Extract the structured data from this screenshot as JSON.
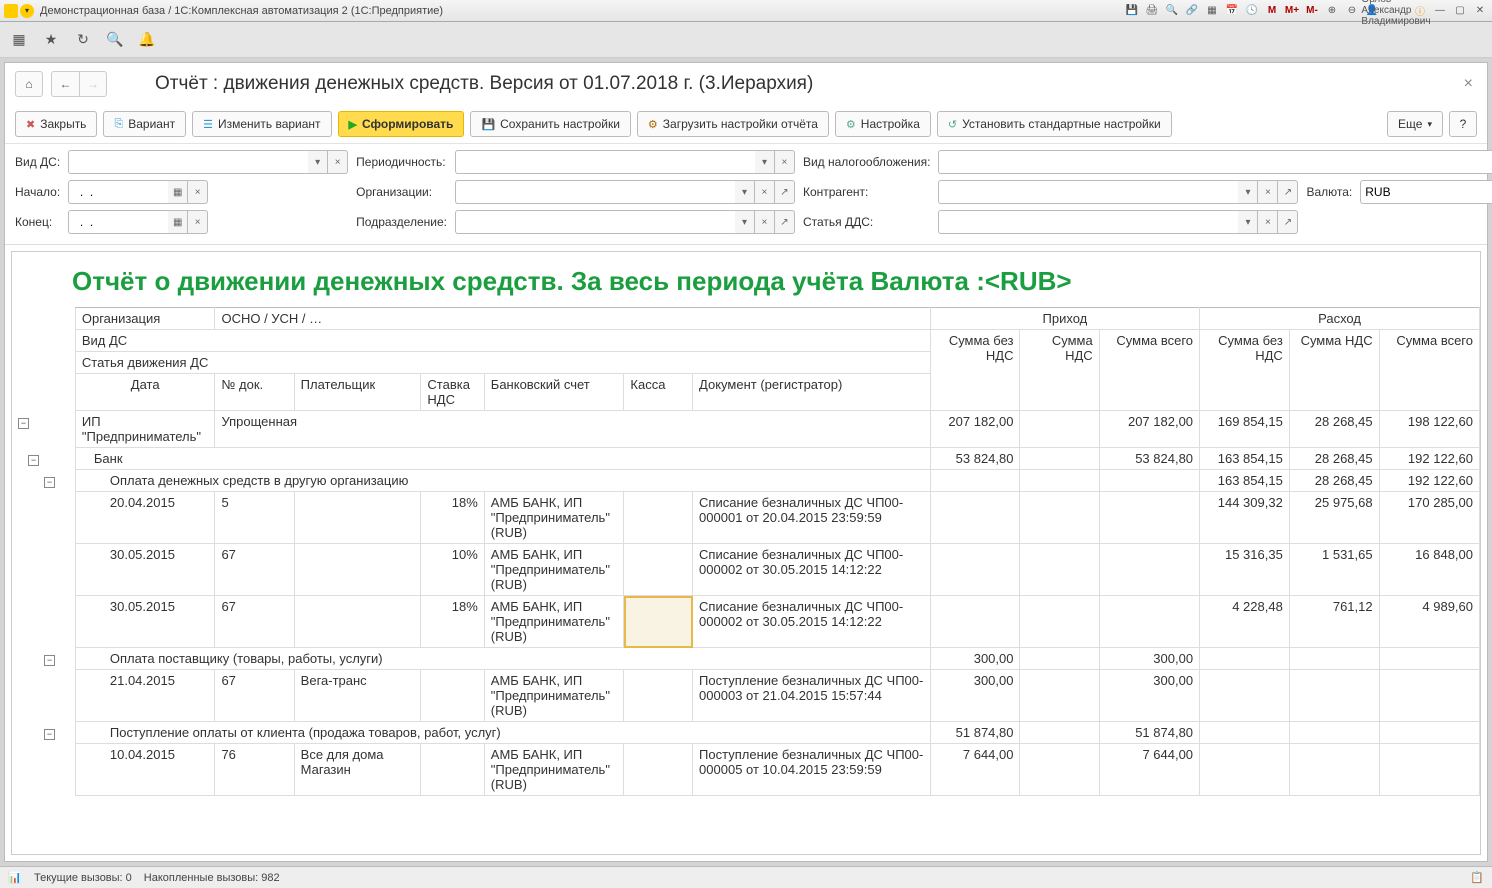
{
  "titlebar": {
    "title": "Демонстрационная база / 1С:Комплексная автоматизация 2  (1С:Предприятие)",
    "user": "Орлов Александр Владимирович",
    "m_labels": [
      "M",
      "M+",
      "M-"
    ]
  },
  "nav_title": "Отчёт : движения денежных средств. Версия от 01.07.2018 г. (3.Иерархия)",
  "cmd": {
    "close": "Закрыть",
    "variant": "Вариант",
    "edit_variant": "Изменить вариант",
    "generate": "Сформировать",
    "save_settings": "Сохранить настройки",
    "load_settings": "Загрузить настройки отчёта",
    "settings": "Настройка",
    "default_settings": "Установить стандартные настройки",
    "more": "Еще"
  },
  "filters": {
    "vid_ds": "Вид ДС:",
    "period": "Периодичность:",
    "tax": "Вид налогообложения:",
    "start": "Начало:",
    "start_val": "  .  .   ",
    "org": "Организации:",
    "contragent": "Контрагент:",
    "currency": "Валюта:",
    "currency_val": "RUB",
    "end": "Конец:",
    "end_val": "  .  .   ",
    "division": "Подразделение:",
    "dds": "Статья ДДС:"
  },
  "report": {
    "title": "Отчёт о движении денежных средств. За весь периода учёта Валюта :<RUB>",
    "org_label": "Организация",
    "tax_mode": "ОСНО / УСН / …",
    "hdr_income": "Приход",
    "hdr_expense": "Расход",
    "hdr_vid_ds": "Вид ДС",
    "hdr_dds": "Статья движения ДС",
    "col_sum_novat": "Сумма без НДС",
    "col_sum_vat": "Сумма НДС",
    "col_sum_total": "Сумма всего",
    "col_date": "Дата",
    "col_docno": "№ док.",
    "col_payer": "Плательщик",
    "col_vat_rate": "Ставка НДС",
    "col_bank": "Банковский счет",
    "col_cash": "Касса",
    "col_doc": "Документ (регистратор)"
  },
  "rows": {
    "r0": {
      "org": "ИП \"Предприниматель\"",
      "tax": "Упрощенная",
      "in_novat": "207 182,00",
      "in_total": "207 182,00",
      "ex_novat": "169 854,15",
      "ex_vat": "28 268,45",
      "ex_total": "198 122,60"
    },
    "r1": {
      "label": "Банк",
      "in_novat": "53 824,80",
      "in_total": "53 824,80",
      "ex_novat": "163 854,15",
      "ex_vat": "28 268,45",
      "ex_total": "192 122,60"
    },
    "r2": {
      "label": "Оплата денежных средств в другую организацию",
      "ex_novat": "163 854,15",
      "ex_vat": "28 268,45",
      "ex_total": "192 122,60"
    },
    "r3": {
      "date": "20.04.2015",
      "docno": "5",
      "rate": "18%",
      "bank": "АМБ БАНК, ИП \"Предприниматель\" (RUB)",
      "doc": "Списание безналичных ДС ЧП00-000001 от 20.04.2015 23:59:59",
      "ex_novat": "144 309,32",
      "ex_vat": "25 975,68",
      "ex_total": "170 285,00"
    },
    "r4": {
      "date": "30.05.2015",
      "docno": "67",
      "rate": "10%",
      "bank": "АМБ БАНК, ИП \"Предприниматель\" (RUB)",
      "doc": "Списание безналичных ДС ЧП00-000002 от 30.05.2015 14:12:22",
      "ex_novat": "15 316,35",
      "ex_vat": "1 531,65",
      "ex_total": "16 848,00"
    },
    "r5": {
      "date": "30.05.2015",
      "docno": "67",
      "rate": "18%",
      "bank": "АМБ БАНК, ИП \"Предприниматель\" (RUB)",
      "doc": "Списание безналичных ДС ЧП00-000002 от 30.05.2015 14:12:22",
      "ex_novat": "4 228,48",
      "ex_vat": "761,12",
      "ex_total": "4 989,60"
    },
    "r6": {
      "label": "Оплата поставщику (товары, работы, услуги)",
      "in_novat": "300,00",
      "in_total": "300,00"
    },
    "r7": {
      "date": "21.04.2015",
      "docno": "67",
      "payer": "Вега-транс",
      "bank": "АМБ БАНК, ИП \"Предприниматель\" (RUB)",
      "doc": "Поступление безналичных ДС ЧП00-000003 от 21.04.2015 15:57:44",
      "in_novat": "300,00",
      "in_total": "300,00"
    },
    "r8": {
      "label": "Поступление оплаты от клиента (продажа товаров, работ, услуг)",
      "in_novat": "51 874,80",
      "in_total": "51 874,80"
    },
    "r9": {
      "date": "10.04.2015",
      "docno": "76",
      "payer": "Все для дома Магазин",
      "bank": "АМБ БАНК, ИП \"Предприниматель\" (RUB)",
      "doc": "Поступление безналичных ДС ЧП00-000005 от 10.04.2015 23:59:59",
      "in_novat": "7 644,00",
      "in_total": "7 644,00"
    }
  },
  "status": {
    "current": "Текущие вызовы: 0",
    "accum": "Накопленные вызовы: 982"
  }
}
